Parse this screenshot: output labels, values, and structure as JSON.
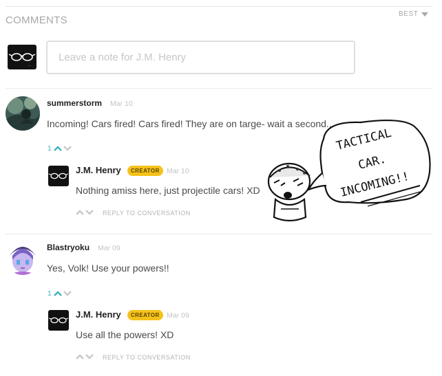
{
  "section": {
    "title": "COMMENTS",
    "sort_label": "BEST"
  },
  "composer": {
    "placeholder": "Leave a note for J.M. Henry"
  },
  "comments": [
    {
      "author": "summerstorm",
      "date": "Mar 10",
      "text": "Incoming! Cars fired! Cars fired! They are on targe- wait a second....",
      "votes": "1",
      "reply": {
        "author": "J.M. Henry",
        "badge": "CREATOR",
        "date": "Mar 10",
        "text": "Nothing amiss here, just projectile cars! XD",
        "action": "REPLY TO CONVERSATION"
      }
    },
    {
      "author": "Blastryoku",
      "date": "Mar 09",
      "text": "Yes, Volk! Use your powers!!",
      "votes": "1",
      "reply": {
        "author": "J.M. Henry",
        "badge": "CREATOR",
        "date": "Mar 09",
        "text": "Use all the powers! XD",
        "action": "REPLY TO CONVERSATION"
      }
    }
  ],
  "sticker": {
    "caption": "TACTICAL CAR. INCOMING!!"
  },
  "colors": {
    "accent_teal": "#3cb4c5",
    "creator_badge": "#f5c21b",
    "muted": "#a8a8a8"
  },
  "icons": [
    "chevron-down-icon",
    "upvote-arrow-icon",
    "downvote-arrow-icon",
    "glasses-avatar-icon"
  ]
}
